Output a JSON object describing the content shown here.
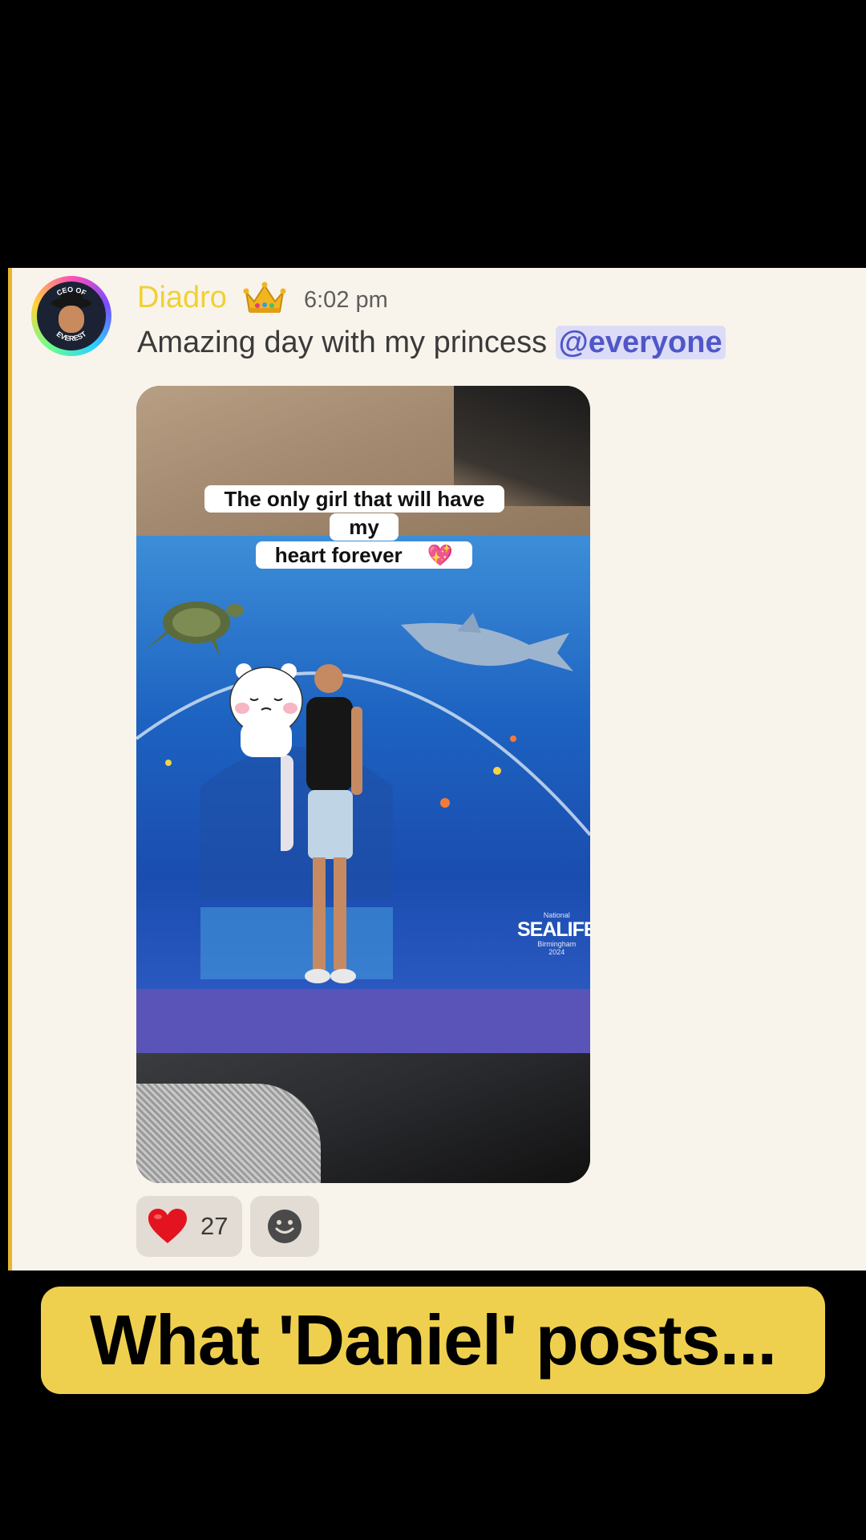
{
  "message": {
    "username": "Diadro",
    "crown_emoji": "👑",
    "timestamp": "6:02 pm",
    "text": "Amazing day with my princess",
    "mention": "@everyone",
    "avatar": {
      "ring_text_top": "CEO OF",
      "ring_text_bottom": "EVEREST"
    }
  },
  "attachment": {
    "caption_line1": "The only girl that will have my",
    "caption_line2": "heart forever",
    "caption_emoji": "💖",
    "logo_small_top": "National",
    "logo_brand": "SEALIFE",
    "logo_small_bottom": "Birmingham",
    "logo_year": "2024"
  },
  "reactions": [
    {
      "emoji": "heart-icon",
      "count": "27"
    },
    {
      "emoji": "add-reaction-icon"
    }
  ],
  "banner": {
    "text": "What 'Daniel' posts..."
  },
  "colors": {
    "username": "#f0d036",
    "mention_bg": "#dcdcf7",
    "mention_text": "#4f57c8",
    "banner_bg": "#efd04e",
    "card_bg": "#f8f4eb"
  }
}
